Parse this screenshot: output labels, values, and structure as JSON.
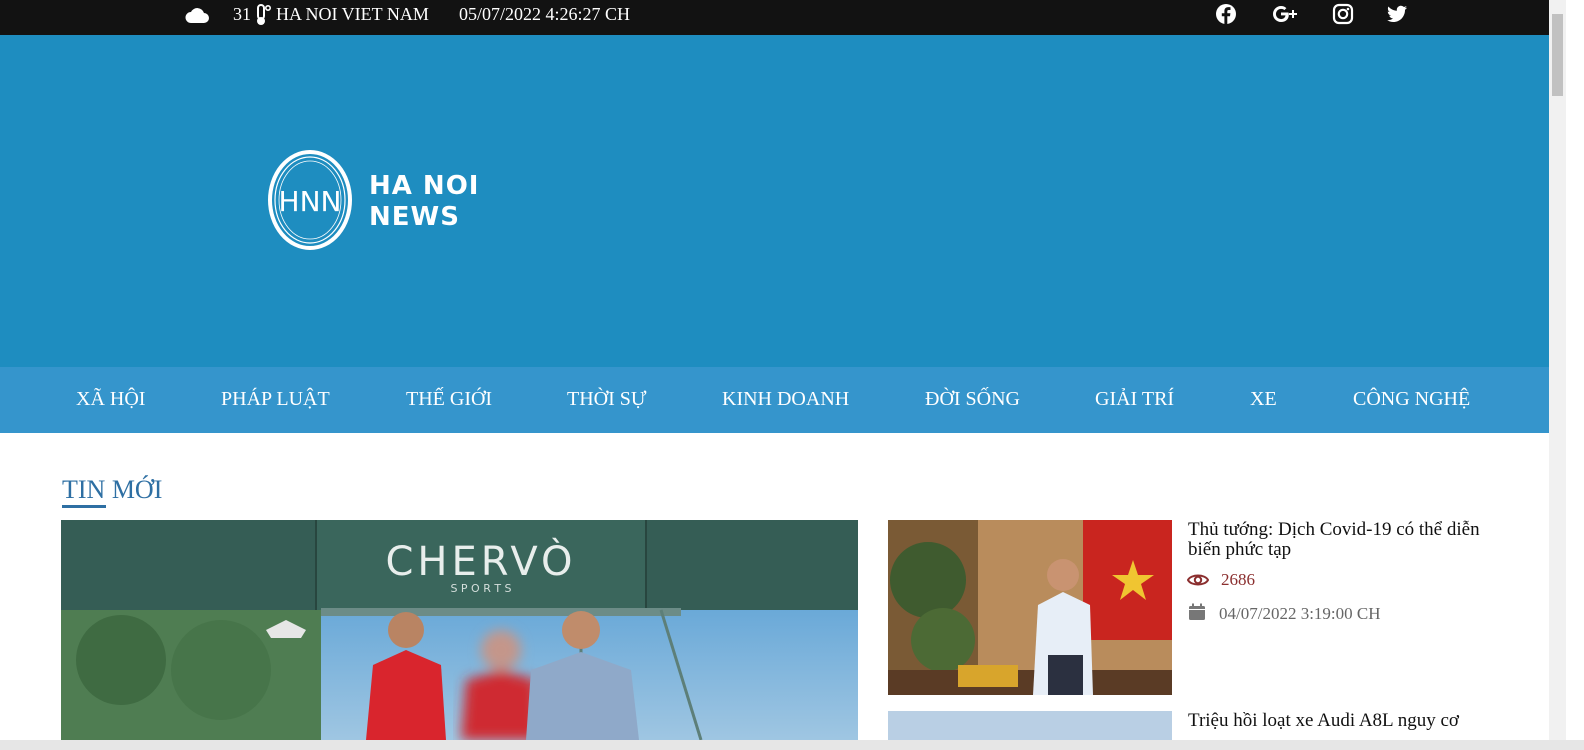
{
  "topbar": {
    "temperature": "31",
    "city": "HA NOI VIET NAM",
    "datetime": "05/07/2022 4:26:27 CH",
    "icons": [
      "cloud-icon",
      "thermometer-icon",
      "facebook-icon",
      "google-plus-icon",
      "instagram-icon",
      "twitter-icon"
    ]
  },
  "header": {
    "logo_mark": "HNN",
    "logo_line1": "HA NOI",
    "logo_line2": "NEWS"
  },
  "nav": {
    "items": [
      {
        "label": "XÃ HỘI"
      },
      {
        "label": "PHÁP LUẬT"
      },
      {
        "label": "THẾ GIỚI"
      },
      {
        "label": "THỜI SỰ"
      },
      {
        "label": "KINH DOANH"
      },
      {
        "label": "ĐỜI SỐNG"
      },
      {
        "label": "GIẢI TRÍ"
      },
      {
        "label": "XE"
      },
      {
        "label": "CÔNG NGHỆ"
      }
    ]
  },
  "section": {
    "title": "TIN MỚI"
  },
  "main_image": {
    "sign_text": "CHERVÒ",
    "sign_sub": "S P O R T S"
  },
  "articles": [
    {
      "title": "Thủ tướng: Dịch Covid-19 có thể diễn biến phức tạp",
      "views": "2686",
      "date": "04/07/2022 3:19:00 CH"
    },
    {
      "title": "Triệu hồi loạt xe Audi A8L nguy cơ"
    }
  ],
  "colors": {
    "topbar": "#121212",
    "header": "#1e8dc0",
    "nav": "#3595cc",
    "section_title": "#2e6fa3",
    "views": "#8b2f2f"
  }
}
